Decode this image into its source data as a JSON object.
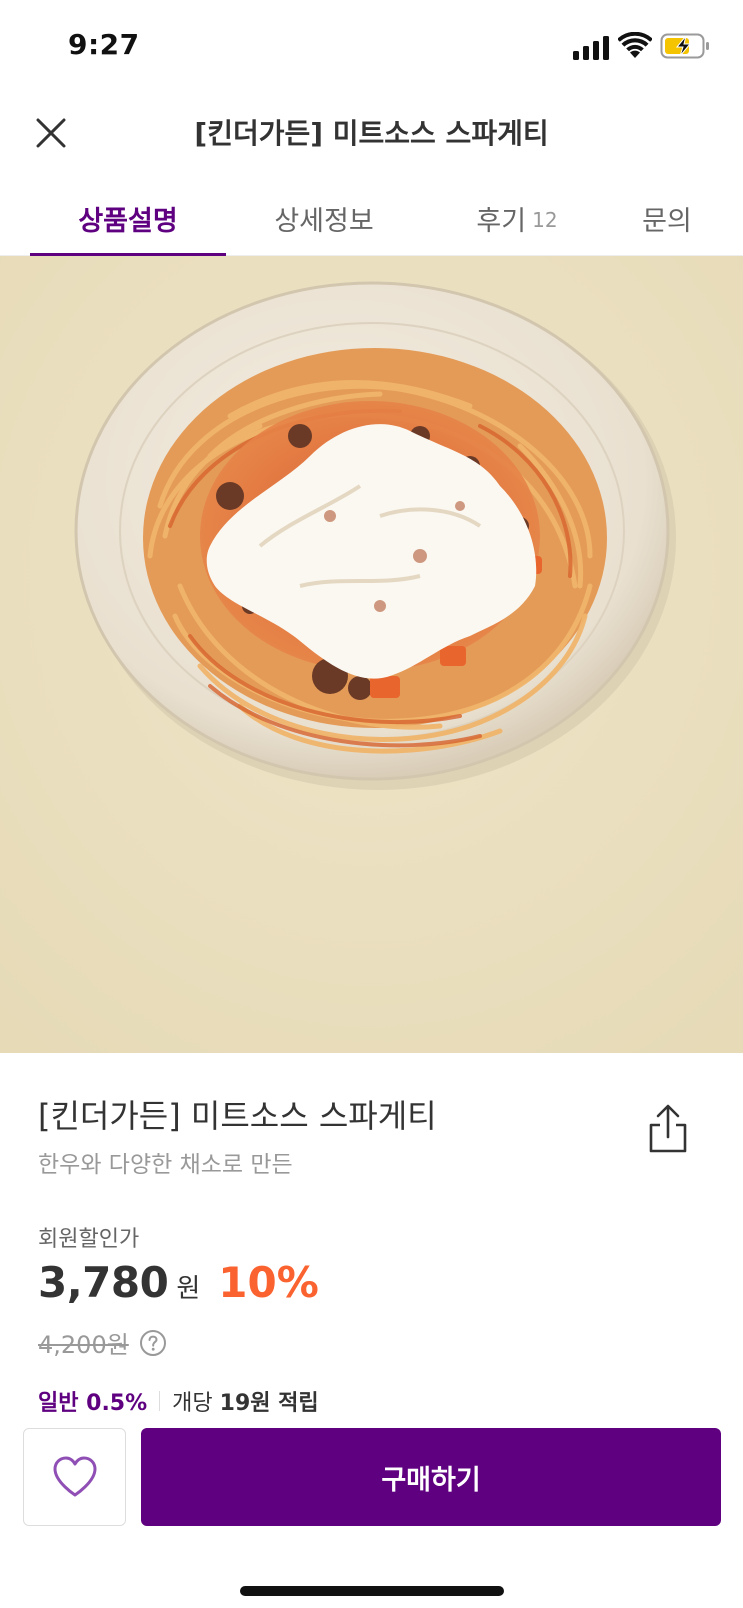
{
  "status_bar": {
    "time": "9:27"
  },
  "header": {
    "title": "[킨더가든] 미트소스 스파게티"
  },
  "tabs": [
    {
      "label": "상품설명",
      "active": true
    },
    {
      "label": "상세정보",
      "active": false
    },
    {
      "label": "후기",
      "count": "12",
      "active": false
    },
    {
      "label": "문의",
      "active": false
    }
  ],
  "product": {
    "name": "[킨더가든] 미트소스 스파게티",
    "description": "한우와 다양한 채소로 만든",
    "price_label": "회원할인가",
    "price": "3,780",
    "currency": "원",
    "discount": "10%",
    "original_price": "4,200원",
    "points": {
      "level": "일반 0.5%",
      "prefix": "개당",
      "amount": "19원 적립"
    }
  },
  "bottom_bar": {
    "buy_label": "구매하기"
  },
  "colors": {
    "brand": "#5f0080",
    "discount": "#fa622f",
    "plate_background": "#ece2c3"
  }
}
